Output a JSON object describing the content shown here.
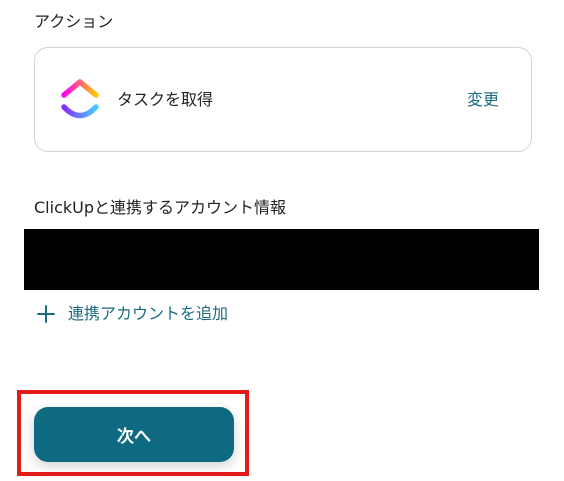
{
  "action_section": {
    "title": "アクション",
    "action_label": "タスクを取得",
    "change_label": "変更",
    "app_icon": "clickup-logo-icon"
  },
  "account_section": {
    "title": "ClickUpと連携するアカウント情報",
    "redacted_color": "#000000",
    "add_account_label": "連携アカウントを追加",
    "add_icon": "plus-icon"
  },
  "footer": {
    "next_label": "次へ",
    "highlight_color": "#e31b1b"
  },
  "colors": {
    "accent": "#1c6a80",
    "button_bg": "#0d6a80"
  }
}
